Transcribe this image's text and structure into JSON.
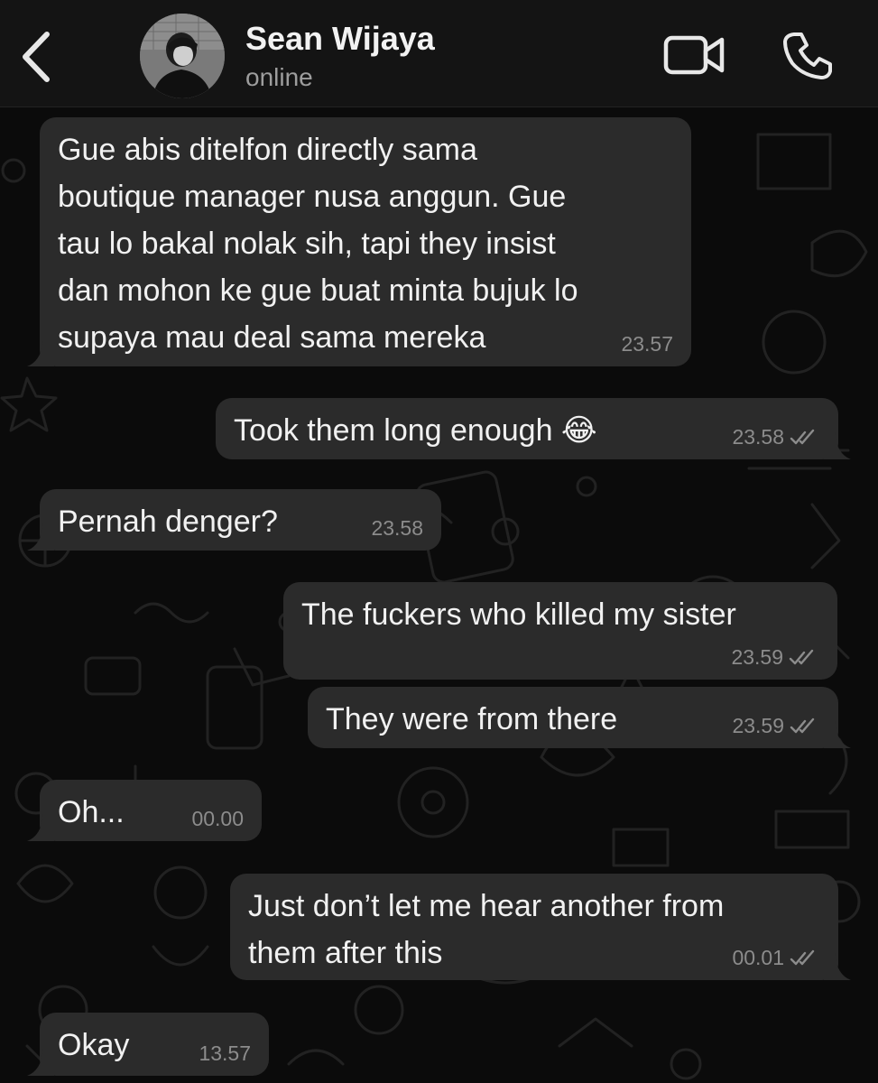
{
  "header": {
    "contact_name": "Sean Wijaya",
    "status": "online",
    "back_icon": "chevron-left-icon",
    "video_icon": "video-camera-icon",
    "call_icon": "phone-icon"
  },
  "colors": {
    "background": "#0b0b0b",
    "header": "#141414",
    "bubble": "#2b2b2b",
    "text": "#f1f1f1",
    "timestamp": "#8c8c8c"
  },
  "messages": [
    {
      "direction": "incoming",
      "text": "Gue abis ditelfon directly sama\nboutique manager nusa anggun. Gue\ntau lo bakal nolak sih, tapi they insist\ndan mohon ke gue buat minta bujuk lo\nsupaya mau deal sama mereka",
      "time": "23.57"
    },
    {
      "direction": "outgoing",
      "text": "Took them long enough 😂",
      "time": "23.58",
      "read": true
    },
    {
      "direction": "incoming",
      "text": "Pernah denger?",
      "time": "23.58"
    },
    {
      "direction": "outgoing",
      "text": "The fuckers who killed my sister",
      "time": "23.59",
      "read": true
    },
    {
      "direction": "outgoing",
      "text": "They were from there",
      "time": "23.59",
      "read": true
    },
    {
      "direction": "incoming",
      "text": "Oh...",
      "time": "00.00"
    },
    {
      "direction": "outgoing",
      "text": "Just don’t let me hear another from\nthem after this",
      "time": "00.01",
      "read": true
    },
    {
      "direction": "incoming",
      "text": "Okay",
      "time": "13.57"
    }
  ]
}
